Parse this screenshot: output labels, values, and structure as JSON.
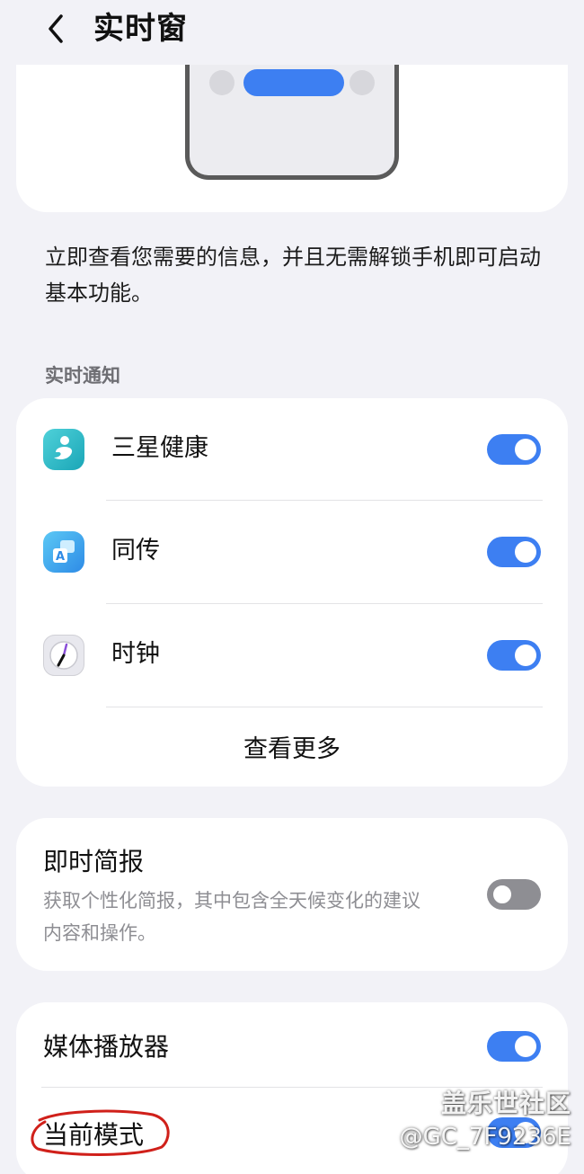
{
  "header": {
    "title": "实时窗"
  },
  "description": "立即查看您需要的信息，并且无需解锁手机即可启动基本功能。",
  "section_label": "实时通知",
  "notifications": {
    "items": [
      {
        "label": "三星健康",
        "icon": "samsung-health-icon",
        "enabled": true
      },
      {
        "label": "同传",
        "icon": "interpreter-icon",
        "enabled": true
      },
      {
        "label": "时钟",
        "icon": "clock-icon",
        "enabled": true
      }
    ],
    "more_label": "查看更多"
  },
  "briefing": {
    "title": "即时简报",
    "subtitle": "获取个性化简报，其中包含全天候变化的建议内容和操作。",
    "enabled": false
  },
  "media": {
    "player_label": "媒体播放器",
    "player_enabled": true,
    "mode_label": "当前模式",
    "mode_enabled": true
  },
  "watermark": {
    "line1": "盖乐世社区",
    "line2": "@GC_7F9236E"
  },
  "colors": {
    "accent": "#3d7ff2",
    "background": "#f2f2f7",
    "card": "#ffffff"
  }
}
